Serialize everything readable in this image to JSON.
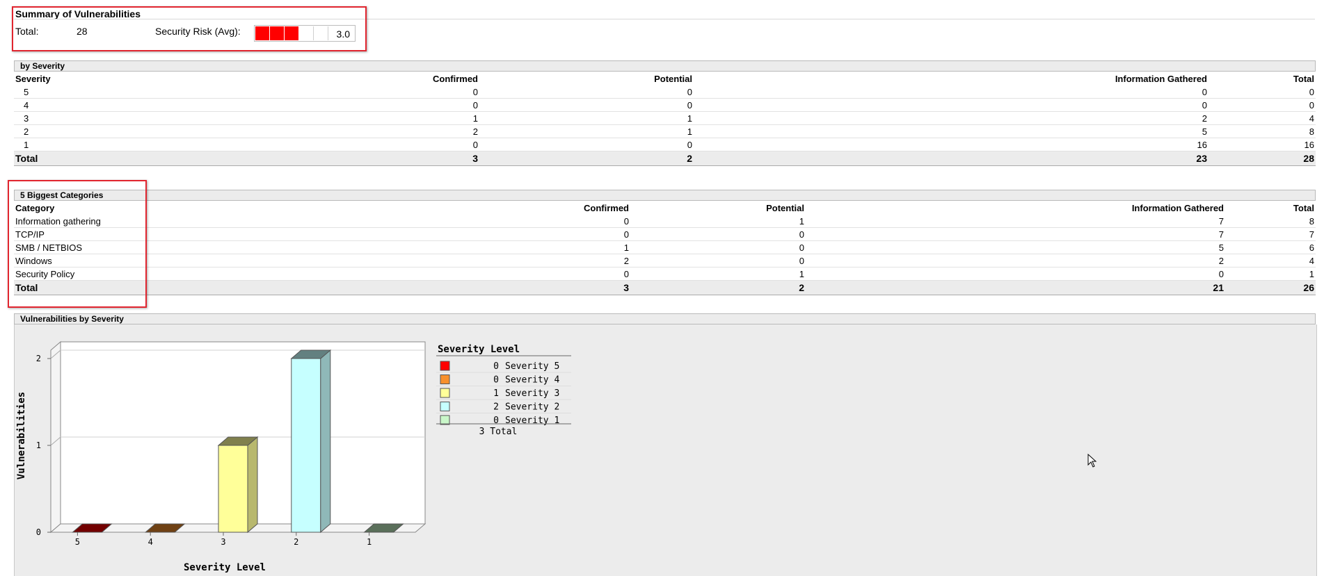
{
  "summary": {
    "title": "Summary of Vulnerabilities",
    "total_label": "Total:",
    "total_value": "28",
    "risk_label": "Security Risk (Avg):",
    "risk_value": "3.0",
    "risk_level": 3,
    "risk_max": 5,
    "risk_color": "#ff0000"
  },
  "by_severity": {
    "title": "by Severity",
    "columns": [
      "Severity",
      "Confirmed",
      "Potential",
      "Information Gathered",
      "Total"
    ],
    "rows": [
      [
        "5",
        "0",
        "0",
        "0",
        "0"
      ],
      [
        "4",
        "0",
        "0",
        "0",
        "0"
      ],
      [
        "3",
        "1",
        "1",
        "2",
        "4"
      ],
      [
        "2",
        "2",
        "1",
        "5",
        "8"
      ],
      [
        "1",
        "0",
        "0",
        "16",
        "16"
      ]
    ],
    "total": [
      "Total",
      "3",
      "2",
      "23",
      "28"
    ]
  },
  "categories": {
    "title": "5 Biggest Categories",
    "columns": [
      "Category",
      "Confirmed",
      "Potential",
      "Information Gathered",
      "Total"
    ],
    "rows": [
      [
        "Information gathering",
        "0",
        "1",
        "7",
        "8"
      ],
      [
        "TCP/IP",
        "0",
        "0",
        "7",
        "7"
      ],
      [
        "SMB / NETBIOS",
        "1",
        "0",
        "5",
        "6"
      ],
      [
        "Windows",
        "2",
        "0",
        "2",
        "4"
      ],
      [
        "Security Policy",
        "0",
        "1",
        "0",
        "1"
      ]
    ],
    "total": [
      "Total",
      "3",
      "2",
      "21",
      "26"
    ]
  },
  "chart_section": {
    "title": "Vulnerabilities by Severity"
  },
  "chart_data": {
    "type": "bar",
    "categories": [
      "5",
      "4",
      "3",
      "2",
      "1"
    ],
    "values": [
      0,
      0,
      1,
      2,
      0
    ],
    "colors": [
      "#ff0000",
      "#f7902c",
      "#ffff99",
      "#c6ffff",
      "#c9f7c9"
    ],
    "xlabel": "Severity Level",
    "ylabel": "Vulnerabilities",
    "ylim": [
      0,
      2
    ],
    "yticks": [
      "0",
      "1",
      "2"
    ],
    "grid": true,
    "legend": {
      "title": "Severity Level",
      "entries": [
        {
          "count": "0",
          "label": "Severity 5",
          "color": "#ff0000"
        },
        {
          "count": "0",
          "label": "Severity 4",
          "color": "#f7902c"
        },
        {
          "count": "1",
          "label": "Severity 3",
          "color": "#ffff99"
        },
        {
          "count": "2",
          "label": "Severity 2",
          "color": "#c6ffff"
        },
        {
          "count": "0",
          "label": "Severity 1",
          "color": "#c9f7c9"
        }
      ],
      "total": "3 Total"
    }
  }
}
